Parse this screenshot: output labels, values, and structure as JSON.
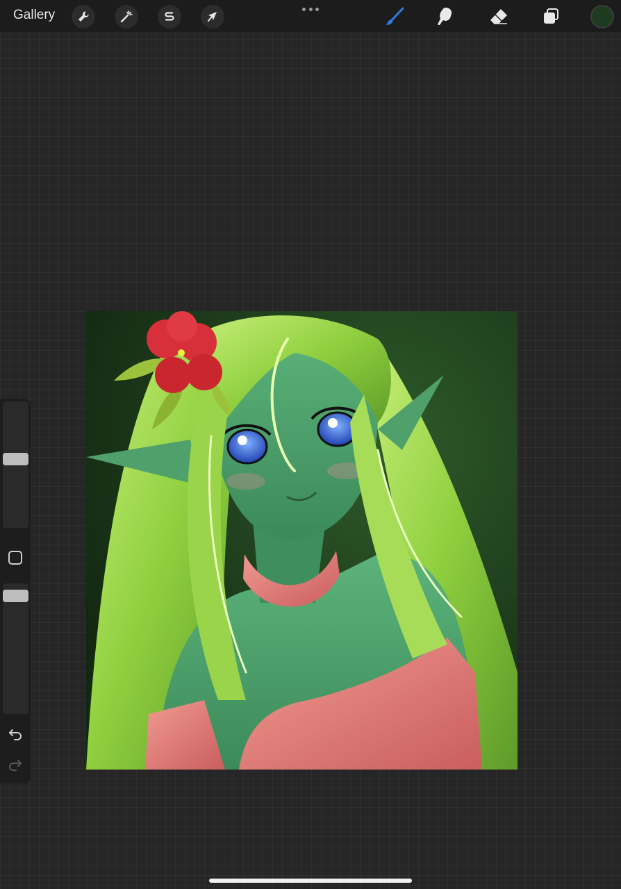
{
  "toolbar": {
    "gallery_label": "Gallery",
    "left_tools": [
      {
        "name": "actions",
        "icon": "wrench-icon"
      },
      {
        "name": "adjustments",
        "icon": "magic-wand-icon"
      },
      {
        "name": "selection",
        "icon": "selection-s-icon"
      },
      {
        "name": "transform",
        "icon": "arrow-cursor-icon"
      }
    ],
    "more_icon": "more-dots-icon",
    "right_tools": [
      {
        "name": "brush",
        "icon": "brush-icon",
        "active": true
      },
      {
        "name": "smudge",
        "icon": "smudge-icon",
        "active": false
      },
      {
        "name": "eraser",
        "icon": "eraser-icon",
        "active": false
      },
      {
        "name": "layers",
        "icon": "layers-icon",
        "active": false
      }
    ],
    "active_color": "#1f3b1f",
    "active_tool_color": "#2f7de1"
  },
  "sidebar": {
    "brush_size_level": 0.55,
    "opacity_level": 0.95,
    "modify_icon": "square-modify-icon",
    "undo_icon": "undo-icon",
    "redo_icon": "redo-icon"
  },
  "canvas": {
    "artwork": "elf-girl-illustration",
    "colors": {
      "background": "#1f3a1c",
      "hair": "#9bd34a",
      "skin": "#4aa06a",
      "eyes": "#2f5fd6",
      "flower": "#d8303a",
      "cloth": "#e07a78"
    }
  }
}
